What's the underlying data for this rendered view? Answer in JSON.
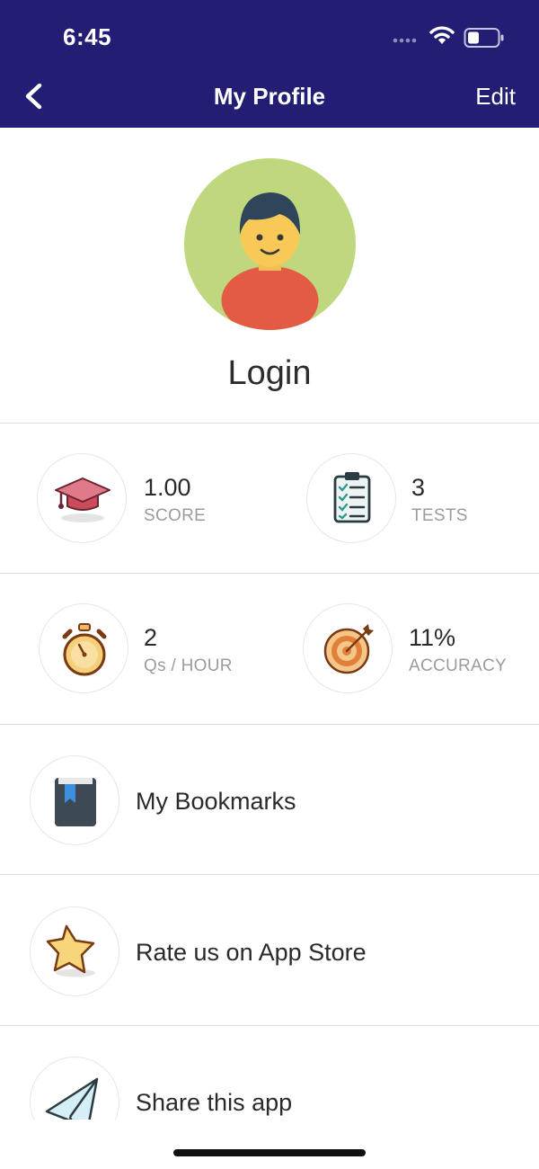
{
  "status_bar": {
    "time": "6:45",
    "signal_icon": "cellular-dots-icon",
    "wifi_icon": "wifi-icon",
    "battery_icon": "battery-icon"
  },
  "nav": {
    "title": "My Profile",
    "edit_label": "Edit",
    "back_icon": "chevron-left-icon"
  },
  "profile": {
    "name": "Login",
    "avatar_icon": "user-avatar-icon"
  },
  "stats": [
    {
      "value": "1.00",
      "label": "SCORE",
      "icon": "graduation-cap-icon"
    },
    {
      "value": "3",
      "label": "TESTS",
      "icon": "clipboard-checklist-icon"
    },
    {
      "value": "2",
      "label": "Qs / HOUR",
      "icon": "stopwatch-icon"
    },
    {
      "value": "11%",
      "label": "ACCURACY",
      "icon": "target-icon"
    }
  ],
  "menu": [
    {
      "label": "My Bookmarks",
      "icon": "bookmark-book-icon"
    },
    {
      "label": "Rate us on App Store",
      "icon": "star-icon"
    },
    {
      "label": "Share this app",
      "icon": "paper-plane-icon"
    }
  ],
  "colors": {
    "header_bg": "#231d73",
    "avatar_bg": "#bfd87e",
    "divider": "#dddddd",
    "label_gray": "#9c9c9c"
  }
}
